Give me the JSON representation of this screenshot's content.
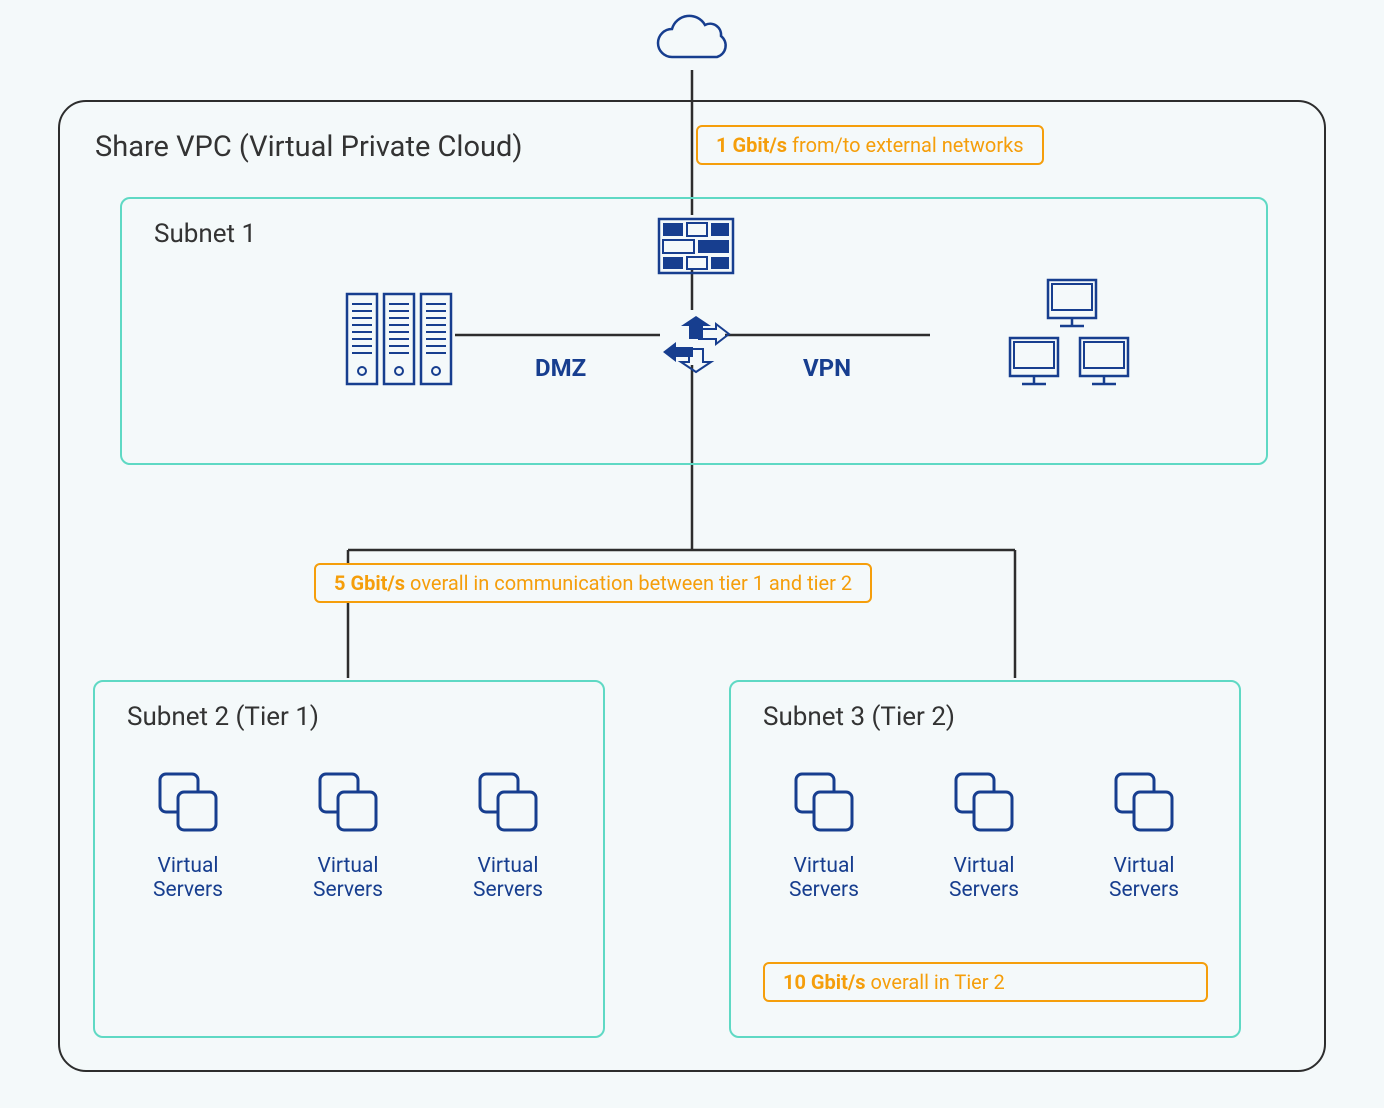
{
  "vpc": {
    "title": "Share VPC (Virtual Private Cloud)"
  },
  "subnets": {
    "s1": {
      "title": "Subnet 1",
      "dmz": "DMZ",
      "vpn": "VPN"
    },
    "s2": {
      "title": "Subnet 2 (Tier 1)",
      "vs": "Virtual Servers"
    },
    "s3": {
      "title": "Subnet 3 (Tier 2)",
      "vs": "Virtual Servers"
    }
  },
  "badges": {
    "external": {
      "strong": "1 Gbit/s",
      "rest": " from/to external networks"
    },
    "between": {
      "strong": "5 Gbit/s",
      "rest": " overall in communication between tier 1 and tier 2"
    },
    "tier2": {
      "strong": "10 Gbit/s",
      "rest": " overall in Tier 2"
    }
  },
  "colors": {
    "navy": "#173e8f",
    "orange": "#f59e0b",
    "teal": "#5fd9c4"
  }
}
